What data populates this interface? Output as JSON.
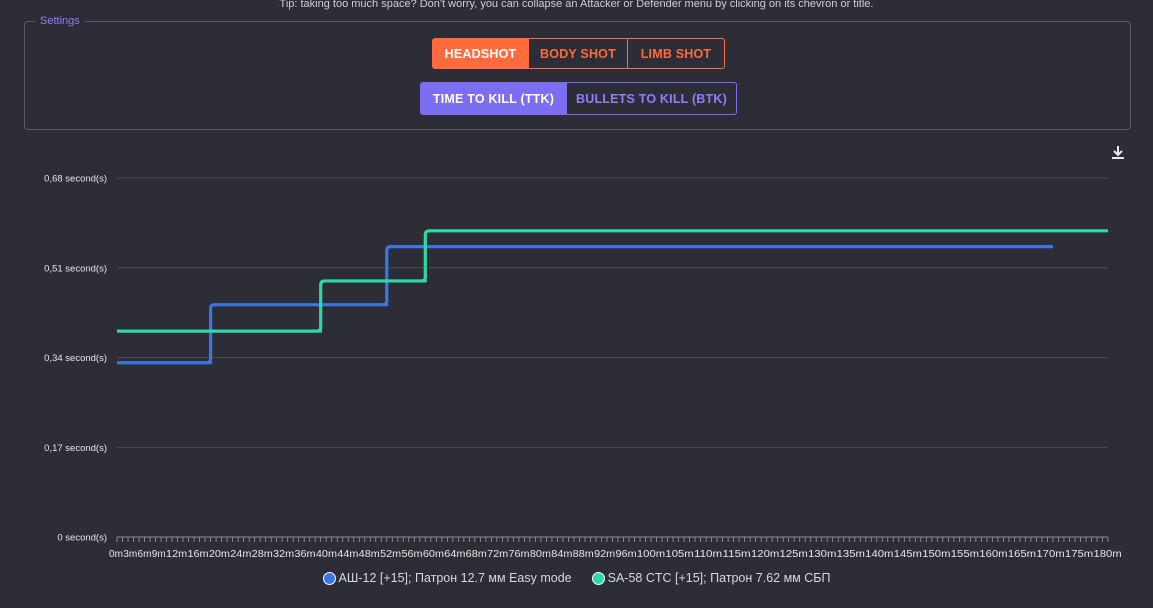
{
  "tip": "Tip: taking too much space? Don't worry, you can collapse an Attacker or Defender menu by clicking on its chevron or title.",
  "settings": {
    "legend": "Settings",
    "hit_zones": [
      {
        "label": "HEADSHOT",
        "active": true
      },
      {
        "label": "BODY SHOT",
        "active": false
      },
      {
        "label": "LIMB SHOT",
        "active": false
      }
    ],
    "metrics": [
      {
        "label": "TIME TO KILL (TTK)",
        "active": true
      },
      {
        "label": "BULLETS TO KILL (BTK)",
        "active": false
      }
    ]
  },
  "download_icon": "download-icon",
  "chart_data": {
    "type": "line",
    "ylim": [
      0,
      0.68
    ],
    "y_ticks": [
      0,
      0.17,
      0.34,
      0.51,
      0.68
    ],
    "y_tick_labels": [
      "0 second(s)",
      "0,17 second(s)",
      "0,34 second(s)",
      "0,51 second(s)",
      "0,68 second(s)"
    ],
    "x_range": [
      0,
      180
    ],
    "x_tick_labels": [
      "0m",
      "3m",
      "6m",
      "9m",
      "12m",
      "16m",
      "20m",
      "24m",
      "28m",
      "32m",
      "36m",
      "40m",
      "44m",
      "48m",
      "52m",
      "56m",
      "60m",
      "64m",
      "68m",
      "72m",
      "76m",
      "80m",
      "84m",
      "88m",
      "92m",
      "96m",
      "100m",
      "105m",
      "110m",
      "115m",
      "120m",
      "125m",
      "130m",
      "135m",
      "140m",
      "145m",
      "150m",
      "155m",
      "160m",
      "165m",
      "170m",
      "175m",
      "180m"
    ],
    "grid": true,
    "legend_position": "bottom",
    "series": [
      {
        "name": "АШ-12 [+15]; Патрон 12.7 мм Easy mode",
        "color": "#3b76e6",
        "x": [
          0,
          17,
          17,
          49,
          49,
          170
        ],
        "y": [
          0.33,
          0.33,
          0.44,
          0.44,
          0.55,
          0.55
        ]
      },
      {
        "name": "SA-58 CTC [+15]; Патрон 7.62 мм СБП",
        "color": "#2ed9a6",
        "x": [
          0,
          37,
          37,
          56,
          56,
          180
        ],
        "y": [
          0.39,
          0.39,
          0.485,
          0.485,
          0.58,
          0.58
        ]
      }
    ]
  }
}
